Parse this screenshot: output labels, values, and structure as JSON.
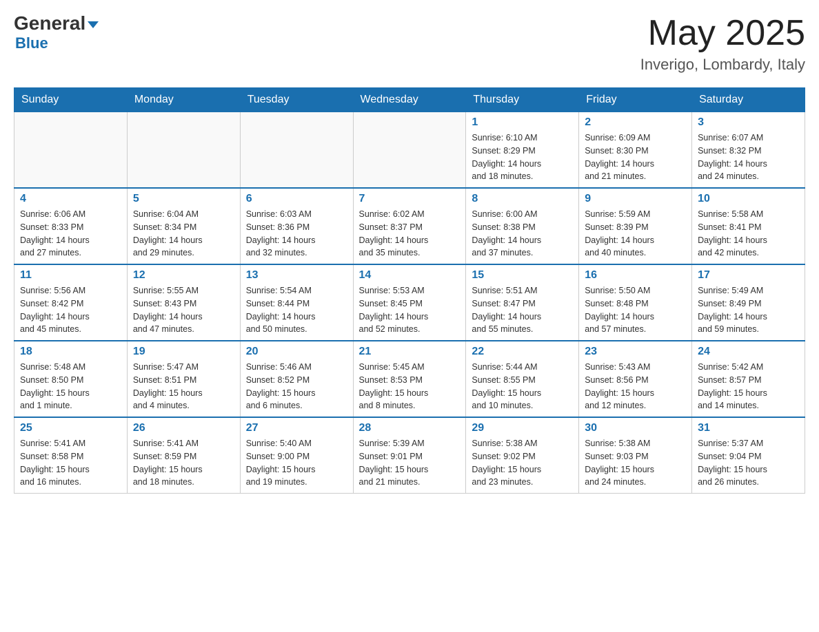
{
  "header": {
    "logo_general": "General",
    "logo_blue": "Blue",
    "month_title": "May 2025",
    "location": "Inverigo, Lombardy, Italy"
  },
  "weekdays": [
    "Sunday",
    "Monday",
    "Tuesday",
    "Wednesday",
    "Thursday",
    "Friday",
    "Saturday"
  ],
  "weeks": [
    [
      {
        "day": "",
        "info": ""
      },
      {
        "day": "",
        "info": ""
      },
      {
        "day": "",
        "info": ""
      },
      {
        "day": "",
        "info": ""
      },
      {
        "day": "1",
        "info": "Sunrise: 6:10 AM\nSunset: 8:29 PM\nDaylight: 14 hours\nand 18 minutes."
      },
      {
        "day": "2",
        "info": "Sunrise: 6:09 AM\nSunset: 8:30 PM\nDaylight: 14 hours\nand 21 minutes."
      },
      {
        "day": "3",
        "info": "Sunrise: 6:07 AM\nSunset: 8:32 PM\nDaylight: 14 hours\nand 24 minutes."
      }
    ],
    [
      {
        "day": "4",
        "info": "Sunrise: 6:06 AM\nSunset: 8:33 PM\nDaylight: 14 hours\nand 27 minutes."
      },
      {
        "day": "5",
        "info": "Sunrise: 6:04 AM\nSunset: 8:34 PM\nDaylight: 14 hours\nand 29 minutes."
      },
      {
        "day": "6",
        "info": "Sunrise: 6:03 AM\nSunset: 8:36 PM\nDaylight: 14 hours\nand 32 minutes."
      },
      {
        "day": "7",
        "info": "Sunrise: 6:02 AM\nSunset: 8:37 PM\nDaylight: 14 hours\nand 35 minutes."
      },
      {
        "day": "8",
        "info": "Sunrise: 6:00 AM\nSunset: 8:38 PM\nDaylight: 14 hours\nand 37 minutes."
      },
      {
        "day": "9",
        "info": "Sunrise: 5:59 AM\nSunset: 8:39 PM\nDaylight: 14 hours\nand 40 minutes."
      },
      {
        "day": "10",
        "info": "Sunrise: 5:58 AM\nSunset: 8:41 PM\nDaylight: 14 hours\nand 42 minutes."
      }
    ],
    [
      {
        "day": "11",
        "info": "Sunrise: 5:56 AM\nSunset: 8:42 PM\nDaylight: 14 hours\nand 45 minutes."
      },
      {
        "day": "12",
        "info": "Sunrise: 5:55 AM\nSunset: 8:43 PM\nDaylight: 14 hours\nand 47 minutes."
      },
      {
        "day": "13",
        "info": "Sunrise: 5:54 AM\nSunset: 8:44 PM\nDaylight: 14 hours\nand 50 minutes."
      },
      {
        "day": "14",
        "info": "Sunrise: 5:53 AM\nSunset: 8:45 PM\nDaylight: 14 hours\nand 52 minutes."
      },
      {
        "day": "15",
        "info": "Sunrise: 5:51 AM\nSunset: 8:47 PM\nDaylight: 14 hours\nand 55 minutes."
      },
      {
        "day": "16",
        "info": "Sunrise: 5:50 AM\nSunset: 8:48 PM\nDaylight: 14 hours\nand 57 minutes."
      },
      {
        "day": "17",
        "info": "Sunrise: 5:49 AM\nSunset: 8:49 PM\nDaylight: 14 hours\nand 59 minutes."
      }
    ],
    [
      {
        "day": "18",
        "info": "Sunrise: 5:48 AM\nSunset: 8:50 PM\nDaylight: 15 hours\nand 1 minute."
      },
      {
        "day": "19",
        "info": "Sunrise: 5:47 AM\nSunset: 8:51 PM\nDaylight: 15 hours\nand 4 minutes."
      },
      {
        "day": "20",
        "info": "Sunrise: 5:46 AM\nSunset: 8:52 PM\nDaylight: 15 hours\nand 6 minutes."
      },
      {
        "day": "21",
        "info": "Sunrise: 5:45 AM\nSunset: 8:53 PM\nDaylight: 15 hours\nand 8 minutes."
      },
      {
        "day": "22",
        "info": "Sunrise: 5:44 AM\nSunset: 8:55 PM\nDaylight: 15 hours\nand 10 minutes."
      },
      {
        "day": "23",
        "info": "Sunrise: 5:43 AM\nSunset: 8:56 PM\nDaylight: 15 hours\nand 12 minutes."
      },
      {
        "day": "24",
        "info": "Sunrise: 5:42 AM\nSunset: 8:57 PM\nDaylight: 15 hours\nand 14 minutes."
      }
    ],
    [
      {
        "day": "25",
        "info": "Sunrise: 5:41 AM\nSunset: 8:58 PM\nDaylight: 15 hours\nand 16 minutes."
      },
      {
        "day": "26",
        "info": "Sunrise: 5:41 AM\nSunset: 8:59 PM\nDaylight: 15 hours\nand 18 minutes."
      },
      {
        "day": "27",
        "info": "Sunrise: 5:40 AM\nSunset: 9:00 PM\nDaylight: 15 hours\nand 19 minutes."
      },
      {
        "day": "28",
        "info": "Sunrise: 5:39 AM\nSunset: 9:01 PM\nDaylight: 15 hours\nand 21 minutes."
      },
      {
        "day": "29",
        "info": "Sunrise: 5:38 AM\nSunset: 9:02 PM\nDaylight: 15 hours\nand 23 minutes."
      },
      {
        "day": "30",
        "info": "Sunrise: 5:38 AM\nSunset: 9:03 PM\nDaylight: 15 hours\nand 24 minutes."
      },
      {
        "day": "31",
        "info": "Sunrise: 5:37 AM\nSunset: 9:04 PM\nDaylight: 15 hours\nand 26 minutes."
      }
    ]
  ]
}
